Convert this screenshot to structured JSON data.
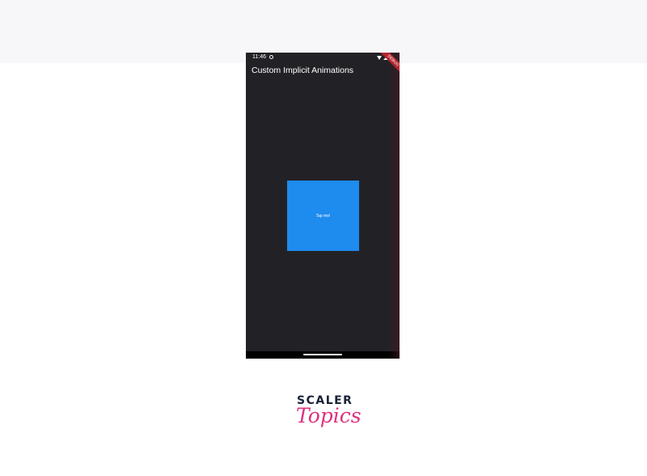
{
  "device": {
    "status_bar": {
      "time": "11:46",
      "icons": [
        "app-notification-icon",
        "wifi-icon",
        "signal-icon",
        "battery-icon"
      ]
    },
    "debug_banner": "DEBUG",
    "app_bar": {
      "title": "Custom Implicit Animations"
    },
    "box": {
      "label": "Tap me!",
      "color": "#1e8bef"
    },
    "background_color": "#222226"
  },
  "branding": {
    "primary": "SCALER",
    "secondary": "Topics",
    "primary_color": "#1a2238",
    "secondary_color": "#e0307f"
  }
}
